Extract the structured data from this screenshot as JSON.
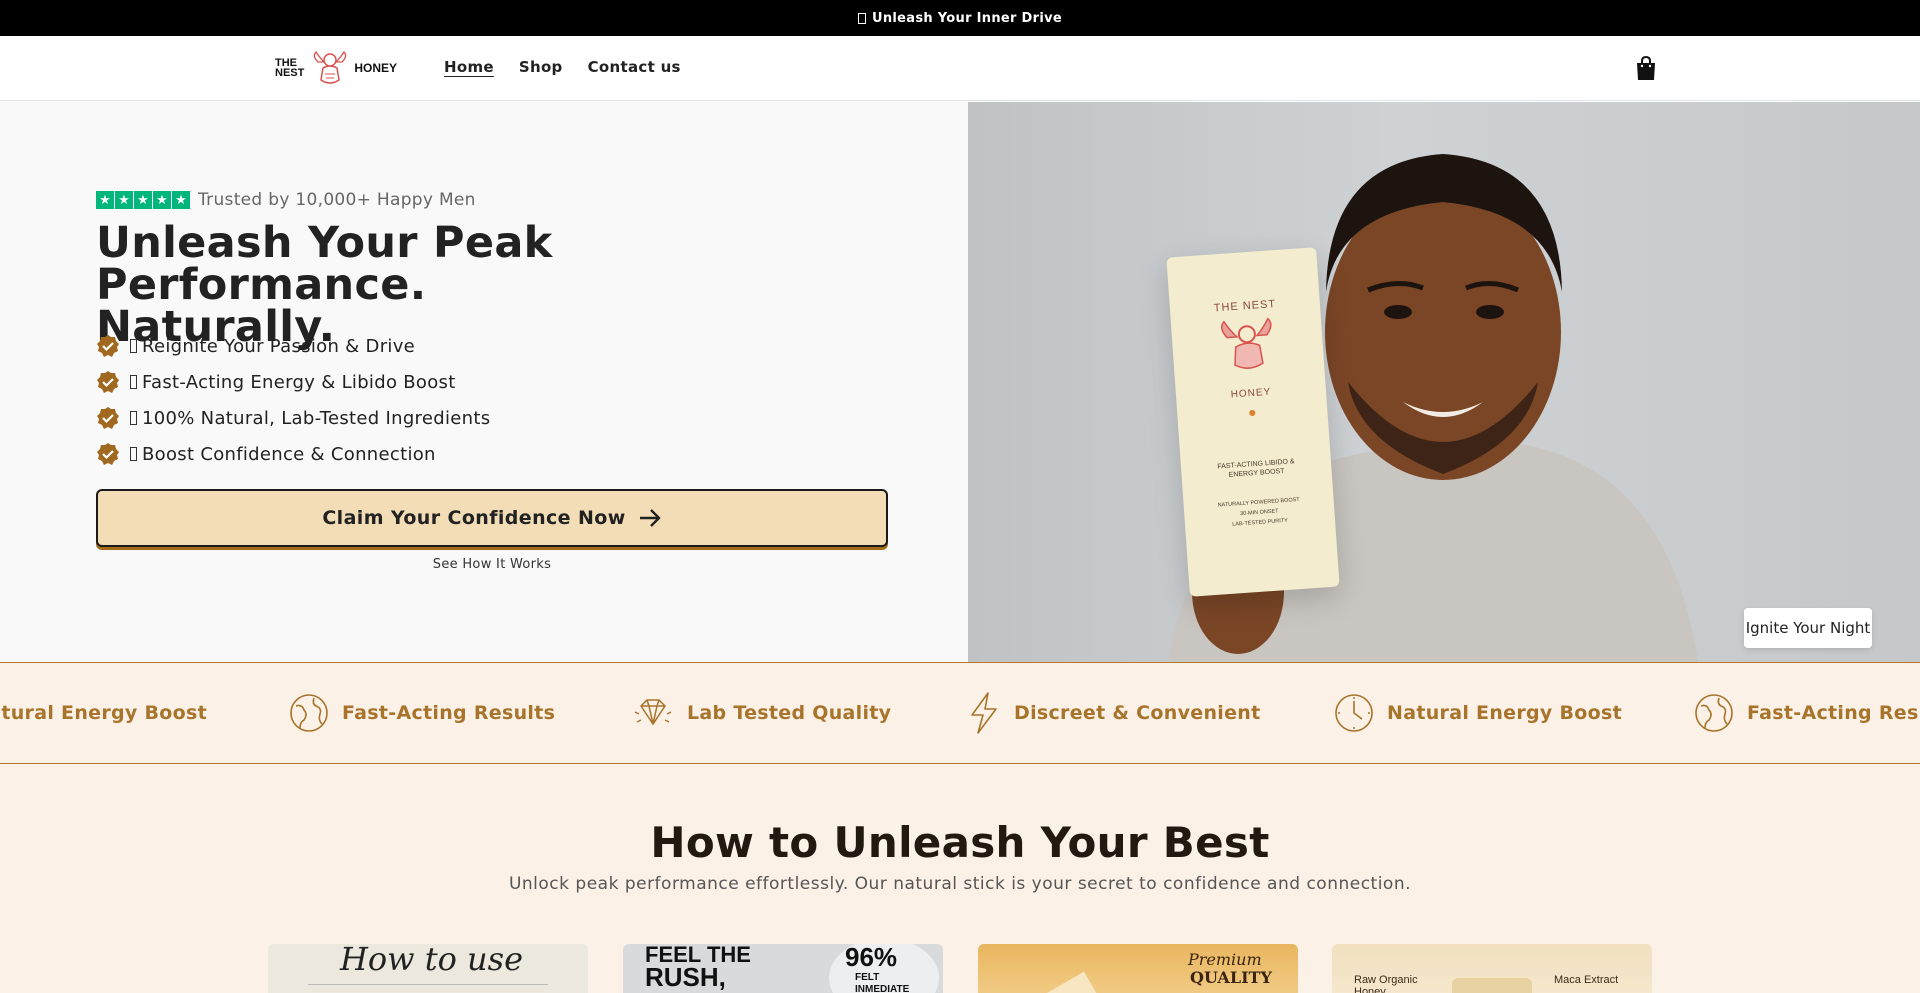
{
  "announcement": {
    "text": "Unleash Your Inner Drive"
  },
  "header": {
    "logo": {
      "the": "THE",
      "nest": "NEST",
      "honey": "HONEY"
    },
    "nav": [
      "Home",
      "Shop",
      "Contact us"
    ],
    "active_nav": "Home",
    "cart_icon": "shopping-bag-icon"
  },
  "hero": {
    "rating_text": "Trusted by 10,000+ Happy Men",
    "rating_stars": 5,
    "title_line1": "Unleash Your Peak Performance.",
    "title_line2": "Naturally.",
    "benefits": [
      "Reignite Your Passion & Drive",
      "Fast-Acting Energy & Libido Boost",
      "100% Natural, Lab-Tested Ingredients",
      "Boost Confidence & Connection"
    ],
    "cta_label": "Claim Your Confidence Now",
    "secondary_link": "See How It Works",
    "image_badge": "Ignite Your Night",
    "product_text": {
      "brand_top": "THE NEST",
      "brand_bottom": "HONEY",
      "tagline": "FAST-ACTING LIBIDO & ENERGY BOOST",
      "bullets": [
        "NATURALLY POWERED BOOST",
        "30-MIN ONSET",
        "LAB-TESTED PURITY"
      ]
    }
  },
  "marquee": {
    "items": [
      {
        "label": "Natural Energy Boost",
        "icon": "clock-icon"
      },
      {
        "label": "Fast-Acting Results",
        "icon": "globe-icon"
      },
      {
        "label": "Lab Tested Quality",
        "icon": "diamond-icon"
      },
      {
        "label": "Discreet & Convenient",
        "icon": "lightning-icon"
      },
      {
        "label": "Natural Energy Boost",
        "icon": "clock-icon"
      },
      {
        "label": "Fast-Acting Results",
        "icon": "globe-icon"
      }
    ]
  },
  "how": {
    "title": "How to Unleash Your Best",
    "subtitle": "Unlock peak performance effortlessly. Our natural stick is your secret to confidence and connection.",
    "cards": [
      {
        "line1": "How to use"
      },
      {
        "line1": "FEEL THE",
        "line2": "RUSH,",
        "stat": "96%",
        "stat_label1": "FELT",
        "stat_label2": "INMEDIATE"
      },
      {
        "line1": "Premium",
        "line2": "QUALITY"
      },
      {
        "left": "Raw Organic Honey",
        "right": "Maca Extract"
      }
    ]
  },
  "colors": {
    "accent": "#a8742b",
    "cta_bg": "#f2ddb7",
    "section_bg": "#fbf1e7",
    "trustpilot": "#00b67a"
  }
}
